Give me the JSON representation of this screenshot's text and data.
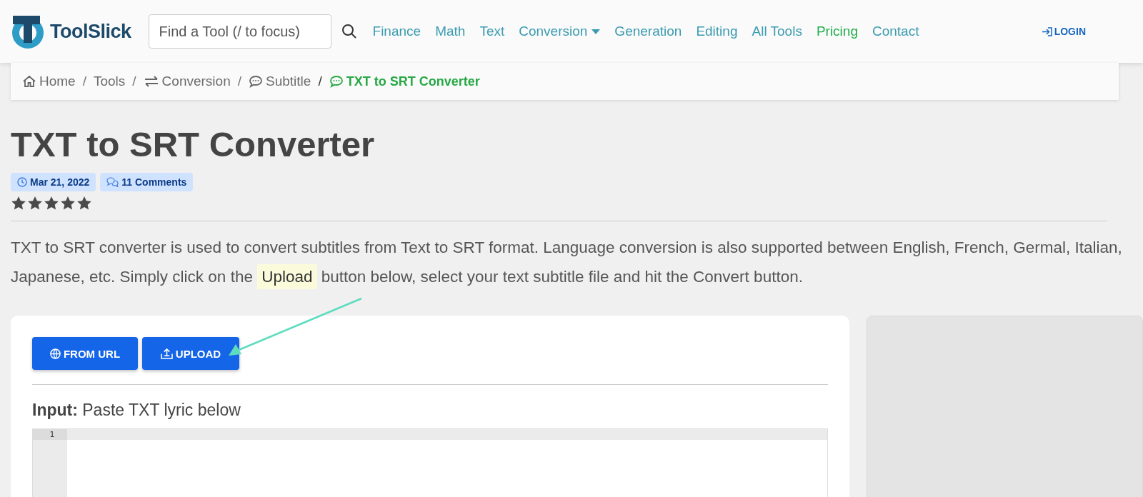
{
  "navbar": {
    "logo_text": "ToolSlick",
    "search": {
      "placeholder": "Find a Tool (/ to focus)"
    },
    "links": [
      {
        "label": "Finance",
        "color": "#3a9bb0",
        "dropdown": false
      },
      {
        "label": "Math",
        "color": "#3a9bb0",
        "dropdown": false
      },
      {
        "label": "Text",
        "color": "#3a9bb0",
        "dropdown": false
      },
      {
        "label": "Conversion",
        "color": "#3a9bb0",
        "dropdown": true
      },
      {
        "label": "Generation",
        "color": "#3a9bb0",
        "dropdown": false
      },
      {
        "label": "Editing",
        "color": "#3a9bb0",
        "dropdown": false
      },
      {
        "label": "All Tools",
        "color": "#3a9bb0",
        "dropdown": false
      },
      {
        "label": "Pricing",
        "color": "#1fae4b",
        "dropdown": false
      },
      {
        "label": "Contact",
        "color": "#3a9bb0",
        "dropdown": false
      }
    ],
    "login": "LOGIN"
  },
  "breadcrumb": [
    {
      "label": "Home",
      "kind": "home",
      "selected": false
    },
    {
      "separator": "/",
      "label": "Tools",
      "kind": "plain",
      "selected": false
    },
    {
      "separator": "/",
      "label": "Conversion",
      "kind": "exchange",
      "selected": false
    },
    {
      "separator": "/",
      "label": "Subtitle",
      "kind": "comment",
      "selected": false
    },
    {
      "separator": "/",
      "label": "TXT to SRT Converter",
      "kind": "comment",
      "selected": true
    }
  ],
  "title": "TXT to SRT Converter",
  "meta": {
    "date": "Mar 21, 2022",
    "comments": "11 Comments",
    "stars": 5
  },
  "description": {
    "before": "TXT to SRT converter is used to convert subtitles from Text to SRT format. Language conversion is also supported between English, French, Germal, Italian, Japanese, etc. Simply click on the",
    "highlight": "Upload",
    "after": "button below, select your text subtitle file and hit the Convert button."
  },
  "tool": {
    "buttons": [
      {
        "label": "FROM URL",
        "kind": "url"
      },
      {
        "label": "UPLOAD",
        "kind": "upload"
      }
    ],
    "input_label_bold": "Input:",
    "input_label": "Paste TXT lyric below",
    "line_numbers": [
      "1"
    ]
  }
}
